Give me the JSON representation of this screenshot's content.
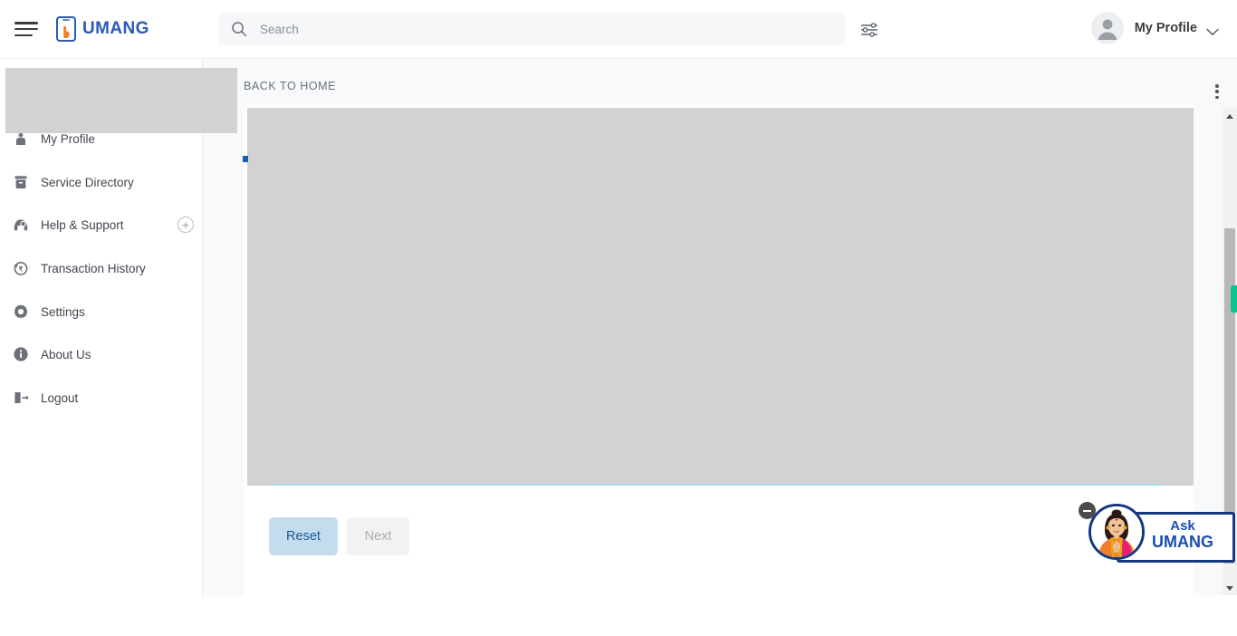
{
  "header": {
    "brand_name": "UMANG",
    "search_placeholder": "Search",
    "search_value": "",
    "profile_label": "My Profile"
  },
  "sidebar": {
    "items": [
      {
        "label": "My Profile",
        "icon": "user-profile-icon",
        "has_expand": false
      },
      {
        "label": "Service Directory",
        "icon": "archive-box-icon",
        "has_expand": false
      },
      {
        "label": "Help & Support",
        "icon": "headset-icon",
        "has_expand": true,
        "expand_glyph": "+"
      },
      {
        "label": "Transaction History",
        "icon": "rupee-history-icon",
        "has_expand": false
      },
      {
        "label": "Settings",
        "icon": "gear-icon",
        "has_expand": false
      },
      {
        "label": "About Us",
        "icon": "info-icon",
        "has_expand": false
      },
      {
        "label": "Logout",
        "icon": "logout-icon",
        "has_expand": false
      }
    ]
  },
  "main": {
    "back_to_home": "BACK TO HOME",
    "buttons": {
      "reset": "Reset",
      "next": "Next"
    }
  },
  "ask_umang": {
    "line1": "Ask",
    "line2": "UMANG"
  },
  "colors": {
    "brand_blue": "#2a5bb5",
    "brand_orange": "#f07f28",
    "reset_bg": "#c3dcee",
    "reset_text": "#1c5b92",
    "next_bg": "#f2f2f2",
    "next_text": "#a9adb3",
    "occluder_gray": "#d2d2d2",
    "cyan_rule": "#a9d9e9",
    "green_tab": "#07c58c",
    "ask_border": "#14387f",
    "ask_text": "#1a4fb0"
  }
}
